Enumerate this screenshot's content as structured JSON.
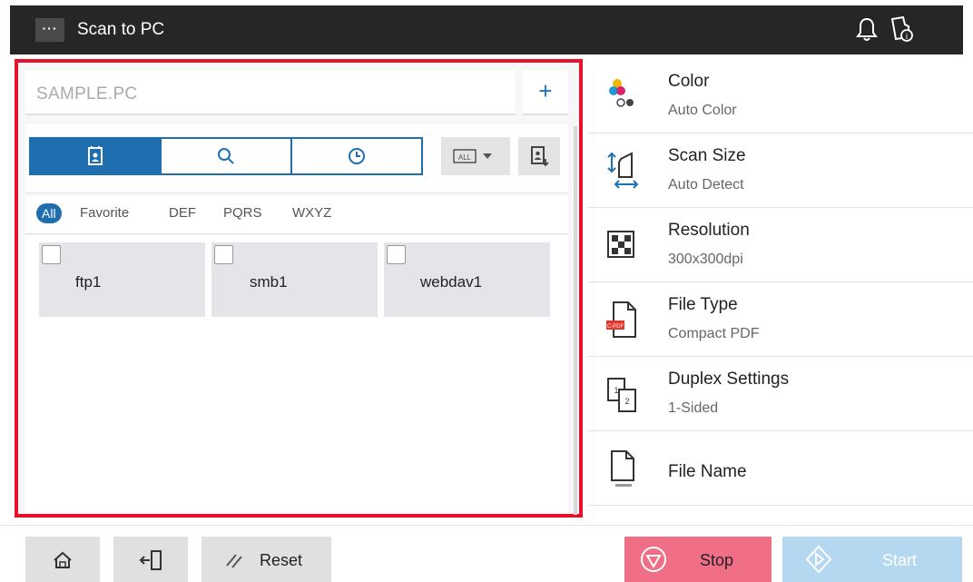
{
  "header": {
    "menu_label": "···",
    "title": "Scan to PC",
    "icons": [
      "bell-icon",
      "job-history-icon"
    ]
  },
  "address_book": {
    "destination_value": "SAMPLE.PC",
    "add_label": "+",
    "tabs": [
      "address-book-icon",
      "search-icon",
      "history-clock-icon"
    ],
    "active_tab": 0,
    "dropdown_label": "ALL",
    "filters": [
      "All",
      "Favorite",
      "DEF",
      "PQRS",
      "WXYZ"
    ],
    "active_filter": "All",
    "destinations": [
      {
        "name": "ftp1",
        "checked": false
      },
      {
        "name": "smb1",
        "checked": false
      },
      {
        "name": "webdav1",
        "checked": false
      }
    ]
  },
  "settings": [
    {
      "label": "Color",
      "value": "Auto Color",
      "icon": "color-icon"
    },
    {
      "label": "Scan Size",
      "value": "Auto Detect",
      "icon": "scan-size-icon"
    },
    {
      "label": "Resolution",
      "value": "300x300dpi",
      "icon": "resolution-icon"
    },
    {
      "label": "File Type",
      "value": "Compact PDF",
      "icon": "file-type-icon",
      "badge": "C-PDF"
    },
    {
      "label": "Duplex Settings",
      "value": "1-Sided",
      "icon": "duplex-icon"
    },
    {
      "label": "File Name",
      "value": "",
      "icon": "file-name-icon"
    }
  ],
  "footer": {
    "reset_label": "Reset",
    "stop_label": "Stop",
    "start_label": "Start"
  },
  "colors": {
    "accent": "#1f6fb0",
    "highlight": "#e8102b",
    "stop": "#f06f86",
    "start": "#b3d8ef"
  }
}
